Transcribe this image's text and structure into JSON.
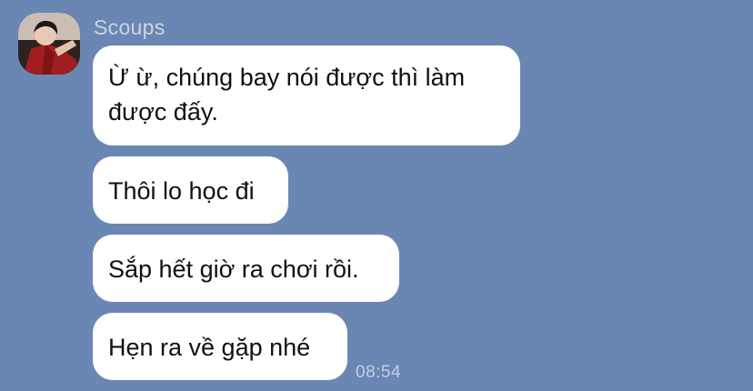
{
  "chat": {
    "sender": "Scoups",
    "messages": [
      "Ừ ừ, chúng bay nói được thì làm\nđược đấy.",
      "Thôi lo học đi",
      "Sắp hết giờ ra chơi rồi.",
      "Hẹn ra về gặp nhé"
    ],
    "timestamp": "08:54"
  },
  "colors": {
    "background": "#6a87b3",
    "bubble": "#ffffff",
    "sender_text": "#c9d4e4"
  },
  "icons": {
    "avatar": "profile-photo"
  }
}
